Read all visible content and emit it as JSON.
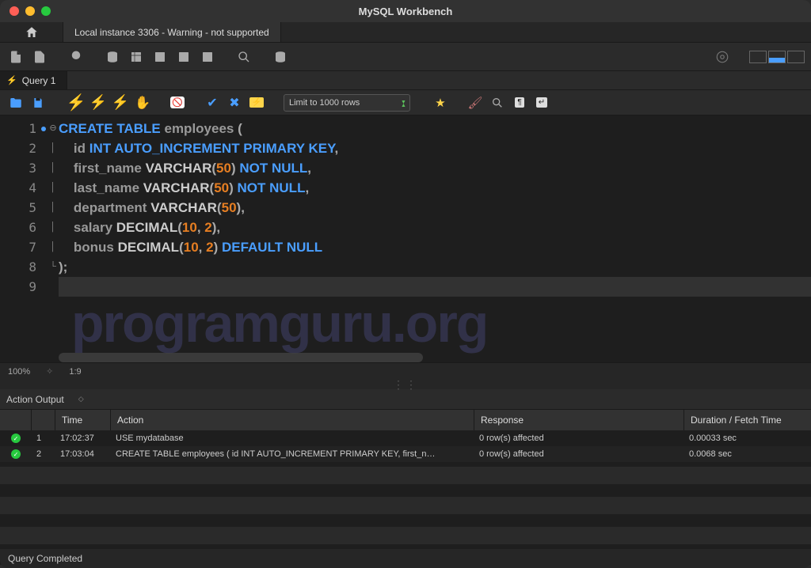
{
  "app": {
    "title": "MySQL Workbench"
  },
  "connection_tab": "Local instance 3306 - Warning - not supported",
  "query_tab": "Query 1",
  "limit_select": "Limit to 1000 rows",
  "zoom": "100%",
  "cursor": "1:9",
  "code": {
    "l1": {
      "a": "CREATE TABLE",
      "b": " employees ",
      "c": "("
    },
    "l2": {
      "a": "    id ",
      "b": "INT AUTO_INCREMENT PRIMARY KEY",
      "c": ","
    },
    "l3": {
      "a": "    first_name ",
      "b": "VARCHAR",
      "c": "(",
      "d": "50",
      "e": ")",
      "f": " NOT NULL",
      "g": ","
    },
    "l4": {
      "a": "    last_name ",
      "b": "VARCHAR",
      "c": "(",
      "d": "50",
      "e": ")",
      "f": " NOT NULL",
      "g": ","
    },
    "l5": {
      "a": "    department ",
      "b": "VARCHAR",
      "c": "(",
      "d": "50",
      "e": ")",
      "f": ","
    },
    "l6": {
      "a": "    salary ",
      "b": "DECIMAL",
      "c": "(",
      "d": "10",
      "e": ", ",
      "f": "2",
      "g": ")",
      "h": ","
    },
    "l7": {
      "a": "    bonus ",
      "b": "DECIMAL",
      "c": "(",
      "d": "10",
      "e": ", ",
      "f": "2",
      "g": ")",
      "h": " DEFAULT NULL"
    },
    "l8": {
      "a": ")",
      "b": ";"
    }
  },
  "watermark": "programguru.org",
  "output_panel": "Action Output",
  "columns": {
    "time": "Time",
    "action": "Action",
    "response": "Response",
    "duration": "Duration / Fetch Time"
  },
  "rows": [
    {
      "n": "1",
      "time": "17:02:37",
      "action": "USE mydatabase",
      "response": "0 row(s) affected",
      "duration": "0.00033 sec"
    },
    {
      "n": "2",
      "time": "17:03:04",
      "action": "CREATE TABLE employees (     id INT AUTO_INCREMENT PRIMARY KEY,     first_n…",
      "response": "0 row(s) affected",
      "duration": "0.0068 sec"
    }
  ],
  "footer": "Query Completed"
}
